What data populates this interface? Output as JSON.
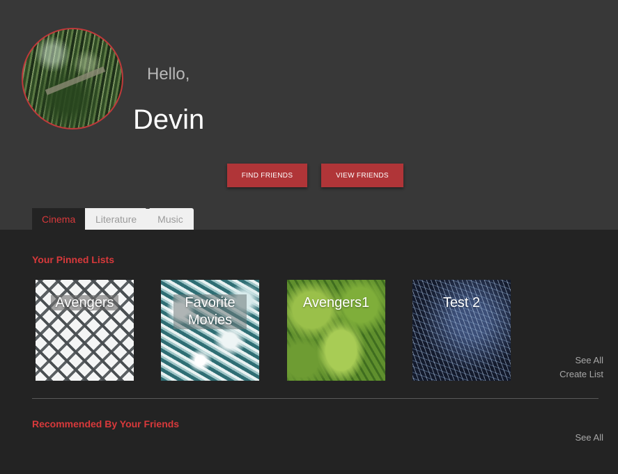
{
  "profile": {
    "greeting": "Hello,",
    "name": "Devin"
  },
  "actions": {
    "find_friends": "FIND FRIENDS",
    "view_friends": "VIEW FRIENDS"
  },
  "tabs": [
    {
      "label": "Cinema",
      "active": true
    },
    {
      "label": "Literature",
      "active": false
    },
    {
      "label": "Music",
      "active": false
    }
  ],
  "pinned": {
    "title": "Your Pinned Lists",
    "lists": [
      {
        "label": "Avengers"
      },
      {
        "label": "Favorite Movies"
      },
      {
        "label": "Avengers1"
      },
      {
        "label": "Test 2"
      }
    ],
    "see_all": "See All",
    "create_list": "Create List"
  },
  "recommended": {
    "title": "Recommended By Your Friends",
    "see_all": "See All"
  },
  "colors": {
    "accent": "#b03538",
    "accent_text": "#d8393b",
    "header_bg": "#383838",
    "content_bg": "#232323"
  }
}
